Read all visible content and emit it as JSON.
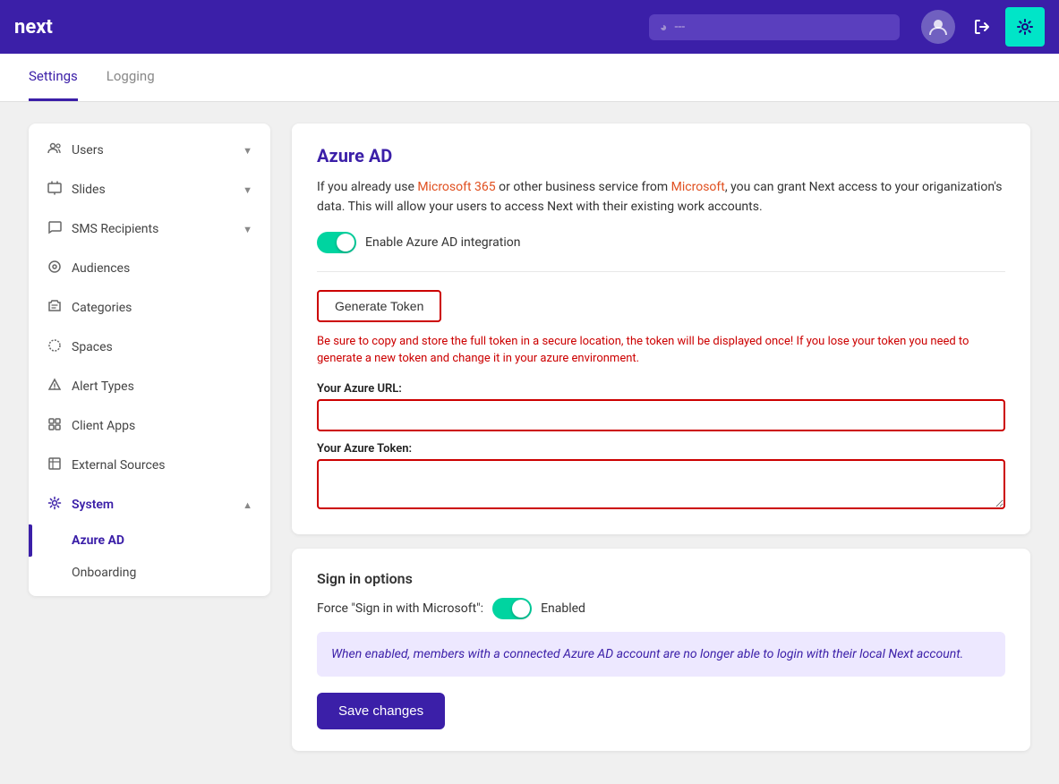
{
  "header": {
    "logo": "next",
    "search_placeholder": "---",
    "search_icon": "compass-icon"
  },
  "tabs": [
    {
      "label": "Settings",
      "active": true
    },
    {
      "label": "Logging",
      "active": false
    }
  ],
  "sidebar": {
    "items": [
      {
        "id": "users",
        "label": "Users",
        "icon": "👤",
        "has_chevron": true,
        "chevron": "▼"
      },
      {
        "id": "slides",
        "label": "Slides",
        "icon": "🖥",
        "has_chevron": true,
        "chevron": "▼"
      },
      {
        "id": "sms-recipients",
        "label": "SMS Recipients",
        "icon": "💬",
        "has_chevron": true,
        "chevron": "▼"
      },
      {
        "id": "audiences",
        "label": "Audiences",
        "icon": "⊙",
        "has_chevron": false
      },
      {
        "id": "categories",
        "label": "Categories",
        "icon": "🏷",
        "has_chevron": false
      },
      {
        "id": "spaces",
        "label": "Spaces",
        "icon": "◎",
        "has_chevron": false
      },
      {
        "id": "alert-types",
        "label": "Alert Types",
        "icon": "△",
        "has_chevron": false
      },
      {
        "id": "client-apps",
        "label": "Client Apps",
        "icon": "⊟",
        "has_chevron": false
      },
      {
        "id": "external-sources",
        "label": "External Sources",
        "icon": "⊡",
        "has_chevron": false
      },
      {
        "id": "system",
        "label": "System",
        "icon": "⚙",
        "has_chevron": true,
        "chevron": "▲",
        "active": true
      }
    ],
    "sub_items": [
      {
        "id": "azure-ad",
        "label": "Azure AD",
        "active": true
      },
      {
        "id": "onboarding",
        "label": "Onboarding",
        "active": false
      }
    ]
  },
  "main": {
    "azure_ad": {
      "title": "Azure AD",
      "description_parts": [
        {
          "text": "If you already use ",
          "style": "normal"
        },
        {
          "text": "Microsoft 365",
          "style": "highlight"
        },
        {
          "text": " or other business service from ",
          "style": "normal"
        },
        {
          "text": "Microsoft",
          "style": "orange"
        },
        {
          "text": ", you can grant Next access to your origanization's data. This will allow your users to access Next with their existing work accounts.",
          "style": "normal"
        }
      ],
      "toggle_label": "Enable Azure AD integration",
      "toggle_enabled": true,
      "generate_token_label": "Generate Token",
      "token_warning": "Be sure to copy and store the full token in a secure location, the token will be displayed once! If you lose your token you need to generate a new token and change it in your azure environment.",
      "azure_url_label": "Your Azure URL:",
      "azure_url_value": "",
      "azure_token_label": "Your Azure Token:",
      "azure_token_value": ""
    },
    "sign_in_options": {
      "title": "Sign in options",
      "force_label": "Force \"Sign in with Microsoft\":",
      "toggle_enabled": true,
      "enabled_text": "Enabled",
      "info_text": "When enabled, members with a connected Azure AD account are no longer able to login with their local Next account.",
      "save_label": "Save changes"
    }
  }
}
